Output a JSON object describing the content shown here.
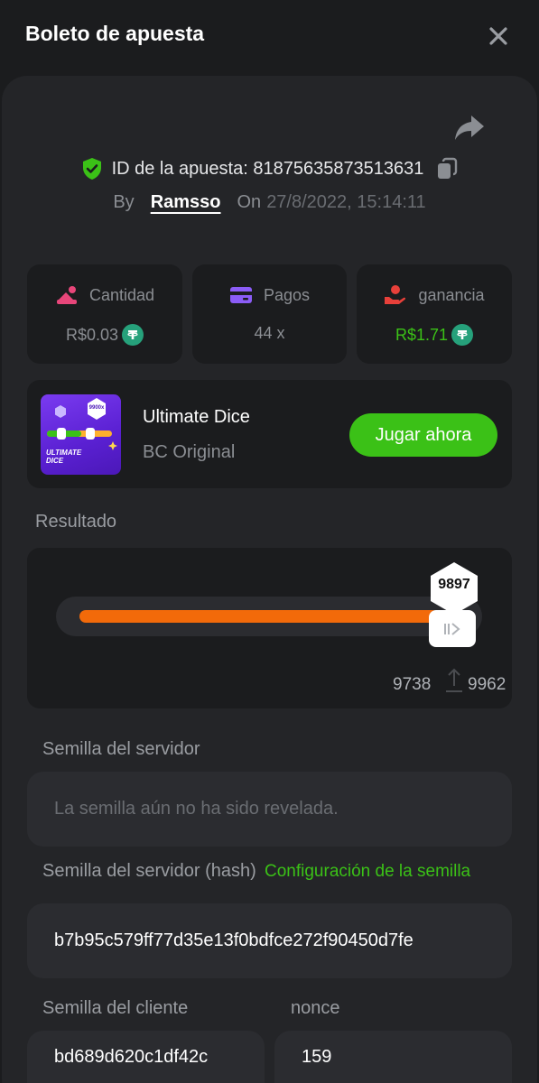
{
  "header": {
    "title": "Boleto de apuesta",
    "close_icon": "close-icon"
  },
  "bet": {
    "id_text": "ID de la apuesta: 81875635873513631",
    "by_label": "By",
    "user": "Ramsso",
    "on_label": "On",
    "date": "27/8/2022, 15:14:11"
  },
  "stats": {
    "amount": {
      "label": "Cantidad",
      "value": "R$0.03",
      "icon": "amount-icon",
      "color": "#e8467a"
    },
    "payout": {
      "label": "Pagos",
      "value": "44 x",
      "icon": "card-icon",
      "color": "#8b5cf6"
    },
    "profit": {
      "label": "ganancia",
      "value": "R$1.71",
      "icon": "profit-hand-icon",
      "color": "#e8403a"
    },
    "currency_icon": "tether-coin-icon"
  },
  "game": {
    "name": "Ultimate Dice",
    "provider": "BC Original",
    "thumb_badge": "9900x",
    "thumb_title": "ULTIMATE DICE",
    "play_label": "Jugar ahora"
  },
  "result": {
    "label": "Resultado",
    "value": "9897",
    "fill_fraction": 0.9897,
    "range_low": "9738",
    "range_high": "9962"
  },
  "seeds": {
    "server_label": "Semilla del servidor",
    "server_placeholder": "La semilla aún no ha sido revelada.",
    "server_hash_label": "Semilla del servidor (hash)",
    "config_link": "Configuración de la semilla",
    "server_hash": "b7b95c579ff77d35e13f0bdfce272f90450d7fe",
    "client_label": "Semilla del cliente",
    "client_seed": "bd689d620c1df42c",
    "nonce_label": "nonce",
    "nonce": "159"
  },
  "colors": {
    "accent_green": "#3bc117",
    "accent_orange": "#f26a0a",
    "tether": "#26a17b",
    "background": "#1b1c1e",
    "panel": "#242528"
  }
}
